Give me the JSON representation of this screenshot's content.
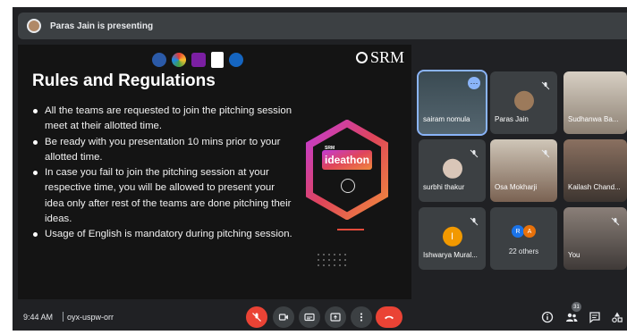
{
  "presenter_banner": {
    "text": "Paras Jain is presenting"
  },
  "slide": {
    "brand": "SRM",
    "title": "Rules and Regulations",
    "bullets": [
      "All the teams are requested to join the pitching session meet at their allotted time.",
      "Be ready with you presentation 10 mins prior to your allotted time.",
      "In case you fail to join the pitching session at your respective time, you will be allowed to present your idea only after rest of the teams are done pitching their ideas.",
      "Usage of English is mandatory during pitching session."
    ],
    "event_logo": {
      "small": "SRM",
      "name": "ideathon"
    }
  },
  "participants": [
    {
      "name": "sairam nomula",
      "camera": true,
      "muted": false
    },
    {
      "name": "Paras Jain",
      "camera": false,
      "muted": true
    },
    {
      "name": "Sudhanwa Ba...",
      "camera": true,
      "muted": false
    },
    {
      "name": "surbhi thakur",
      "camera": false,
      "muted": true
    },
    {
      "name": "Osa Mokharji",
      "camera": true,
      "muted": true
    },
    {
      "name": "Kailash Chand...",
      "camera": true,
      "muted": false
    },
    {
      "name": "Ishwarya Mural...",
      "camera": false,
      "muted": true,
      "initial": "I"
    },
    {
      "name": "22 others",
      "avatars": [
        "R",
        "A"
      ]
    },
    {
      "name": "You",
      "camera": true,
      "muted": true
    }
  ],
  "bottom_bar": {
    "time": "9:44 AM",
    "meeting_code": "oyx-uspw-orr",
    "people_count": "31"
  },
  "colors": {
    "background": "#202124",
    "tile": "#3c4043",
    "end_call": "#ea4335",
    "accent": "#8ab4f8"
  }
}
